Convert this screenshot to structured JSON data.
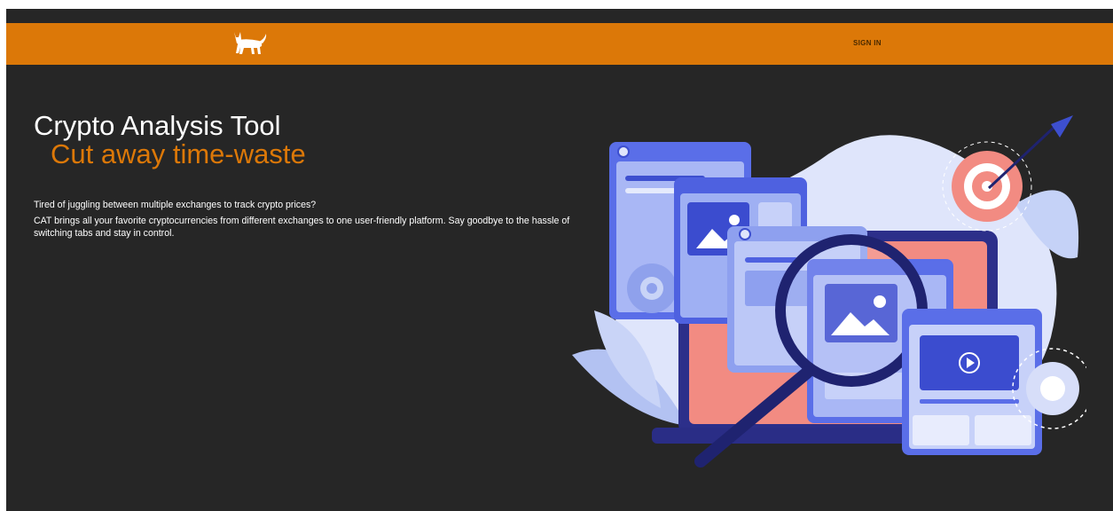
{
  "header": {
    "logo_icon": "cat-icon",
    "sign_in_label": "SIGN IN",
    "brand_color": "#dc7808"
  },
  "hero": {
    "title": "Crypto Analysis Tool",
    "subtitle": "Cut away time-waste",
    "intro": "Tired of juggling between multiple exchanges to track crypto prices?",
    "body": "CAT brings all your favorite cryptocurrencies from different exchanges to one user-friendly platform. Say goodbye to the hassle of switching tabs and stay in control."
  },
  "illustration": {
    "icons": [
      "target-icon",
      "arrow-icon",
      "magnifier-icon",
      "image-icon",
      "play-icon",
      "gear-icon"
    ]
  }
}
